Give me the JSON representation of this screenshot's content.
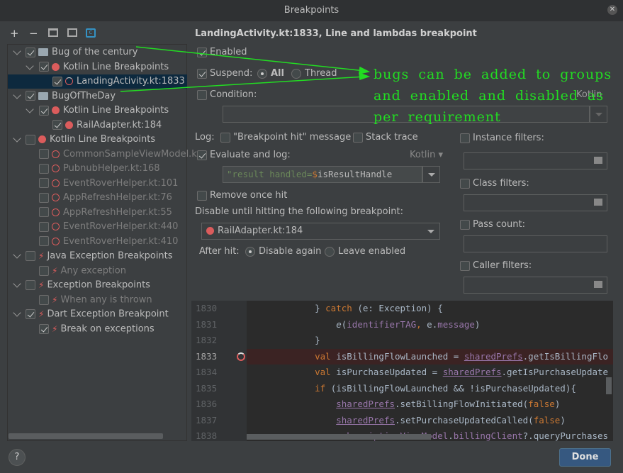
{
  "window": {
    "title": "Breakpoints"
  },
  "toolbar": {
    "add": "+",
    "remove": "−",
    "icons": [
      "group-icon",
      "group-file-icon",
      "export-icon"
    ]
  },
  "tree": [
    {
      "label": "Bug of the century",
      "level": 0,
      "checked": true,
      "kind": "folder",
      "expanded": true
    },
    {
      "label": "Kotlin Line Breakpoints",
      "level": 1,
      "checked": true,
      "kind": "dot",
      "expanded": true
    },
    {
      "label": "LandingActivity.kt:1833",
      "level": 2,
      "checked": true,
      "kind": "log",
      "selected": true
    },
    {
      "label": "BugOfTheDay",
      "level": 0,
      "checked": true,
      "kind": "folder",
      "expanded": true
    },
    {
      "label": "Kotlin Line Breakpoints",
      "level": 1,
      "checked": true,
      "kind": "dot",
      "expanded": true
    },
    {
      "label": "RailAdapter.kt:184",
      "level": 2,
      "checked": true,
      "kind": "dot"
    },
    {
      "label": "Kotlin Line Breakpoints",
      "level": 0,
      "checked": false,
      "kind": "dot",
      "expanded": true
    },
    {
      "label": "CommonSampleViewModel.k",
      "level": 1,
      "checked": false,
      "kind": "odot",
      "disabled": true
    },
    {
      "label": "PubnubHelper.kt:168",
      "level": 1,
      "checked": false,
      "kind": "odot",
      "disabled": true
    },
    {
      "label": "EventRoverHelper.kt:101",
      "level": 1,
      "checked": false,
      "kind": "odot",
      "disabled": true
    },
    {
      "label": "AppRefreshHelper.kt:76",
      "level": 1,
      "checked": false,
      "kind": "odot",
      "disabled": true
    },
    {
      "label": "AppRefreshHelper.kt:55",
      "level": 1,
      "checked": false,
      "kind": "odot",
      "disabled": true
    },
    {
      "label": "EventRoverHelper.kt:440",
      "level": 1,
      "checked": false,
      "kind": "odot",
      "disabled": true
    },
    {
      "label": "EventRoverHelper.kt:410",
      "level": 1,
      "checked": false,
      "kind": "odot",
      "disabled": true
    },
    {
      "label": "Java Exception Breakpoints",
      "level": 0,
      "checked": false,
      "kind": "bolt",
      "expanded": true
    },
    {
      "label": "Any exception",
      "level": 1,
      "checked": false,
      "kind": "bolt",
      "disabled": true
    },
    {
      "label": "Exception Breakpoints",
      "level": 0,
      "checked": false,
      "kind": "bolt",
      "expanded": true
    },
    {
      "label": "When any is thrown",
      "level": 1,
      "checked": false,
      "kind": "bolt",
      "disabled": true
    },
    {
      "label": "Dart Exception Breakpoint",
      "level": 0,
      "checked": true,
      "kind": "bolt",
      "expanded": true
    },
    {
      "label": "Break on exceptions",
      "level": 1,
      "checked": true,
      "kind": "bolt"
    }
  ],
  "detail": {
    "heading": "LandingActivity.kt:1833, Line and lambdas breakpoint",
    "enabled": "Enabled",
    "suspend": "Suspend:",
    "all": "All",
    "thread": "Thread",
    "condition": "Condition:",
    "condition_lang": "Kotlin",
    "log": "Log:",
    "bp_hit": "\"Breakpoint hit\" message",
    "stack_trace": "Stack trace",
    "eval_log": "Evaluate and log:",
    "eval_lang": "Kotlin",
    "eval_str": "\"result handled=",
    "eval_dollar": "$",
    "eval_rest": "isResultHandle",
    "remove_once": "Remove once hit",
    "disable_until": "Disable until hitting the following breakpoint:",
    "disable_value": "RailAdapter.kt:184",
    "after_hit": "After hit:",
    "disable_again": "Disable again",
    "leave_enabled": "Leave enabled",
    "instance_filters": "Instance filters:",
    "class_filters": "Class filters:",
    "pass_count": "Pass count:",
    "caller_filters": "Caller filters:"
  },
  "annotation": [
    "bugs can be added to groups",
    "and enabled and disabled as",
    "per requirement"
  ],
  "code": [
    {
      "n": "1830",
      "html": "    } <span class=kw>catch</span> (e: Exception) {"
    },
    {
      "n": "1831",
      "html": "        <i>e</i>(<span class=pu>identifierTAG</span><span class=kw>,</span> e.<span class=pu>message</span>)"
    },
    {
      "n": "1832",
      "html": "    }"
    },
    {
      "n": "1833",
      "html": "    <span class=kw>val</span> isBillingFlowLaunched = <span class=ul>sharedPrefs</span>.getIsBillingFlo",
      "bp": true
    },
    {
      "n": "1834",
      "html": "    <span class=kw>val</span> isPurchaseUpdated = <span class=ul>sharedPrefs</span>.getIsPurchaseUpdate"
    },
    {
      "n": "1835",
      "html": "    <span class=kw>if</span> (isBillingFlowLaunched && !isPurchaseUpdated){"
    },
    {
      "n": "1836",
      "html": "        <span class=ul>sharedPrefs</span>.setBillingFlowInitiated(<span class=kw>false</span>)"
    },
    {
      "n": "1837",
      "html": "        <span class=ul>sharedPrefs</span>.setPurchaseUpdatedCalled(<span class=kw>false</span>)"
    },
    {
      "n": "1838",
      "html": "        <span class=pu>subscriptionViewModel</span>.<span class=pu>billingClient</span>?.queryPurchases"
    }
  ],
  "footer": {
    "help": "?",
    "done": "Done"
  },
  "colors": {
    "accent": "#365880",
    "breakpoint": "#db5c5c",
    "annotation": "#22dd22"
  }
}
